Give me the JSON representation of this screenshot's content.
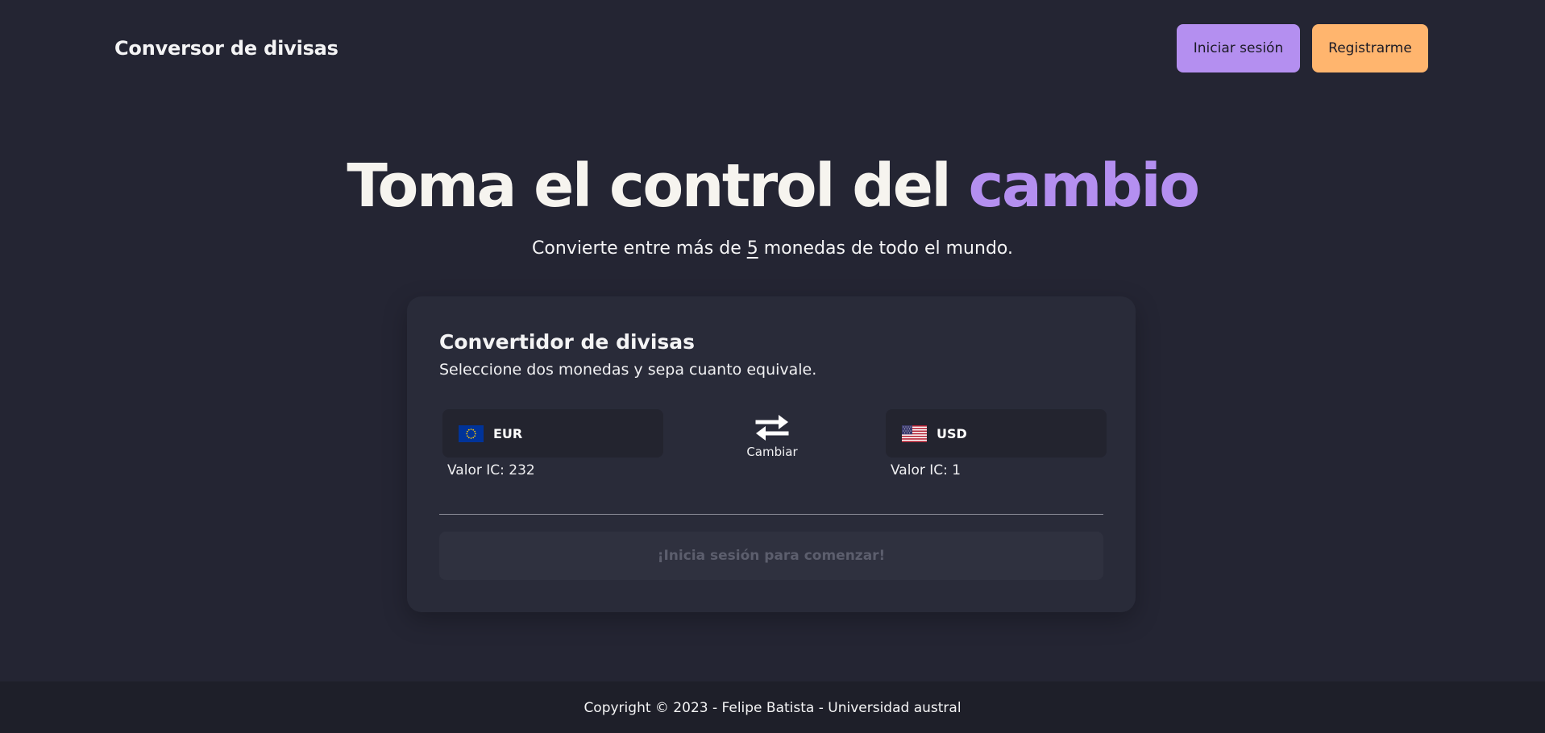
{
  "navbar": {
    "brand": "Conversor de divisas",
    "login_label": "Iniciar sesión",
    "register_label": "Registrarme"
  },
  "hero": {
    "title_main": "Toma el control del ",
    "title_accent": "cambio",
    "subtitle_before": "Convierte entre más de ",
    "subtitle_count": "5",
    "subtitle_after": " monedas de todo el mundo."
  },
  "converter": {
    "title": "Convertidor de divisas",
    "subtitle": "Seleccione dos monedas y sepa cuanto equivale.",
    "from": {
      "code": "EUR",
      "flag_icon": "eu-flag-icon",
      "ic_label": "Valor IC: 232"
    },
    "to": {
      "code": "USD",
      "flag_icon": "us-flag-icon",
      "ic_label": "Valor IC: 1"
    },
    "swap_label": "Cambiar",
    "start_label": "¡Inicia sesión para comenzar!"
  },
  "footer": {
    "text": "Copyright © 2023 - Felipe Batista - Universidad austral"
  },
  "colors": {
    "background": "#242533",
    "accent": "#b48ff0",
    "register": "#ffb56e",
    "card": "#292b39",
    "footer": "#1e1f29"
  }
}
